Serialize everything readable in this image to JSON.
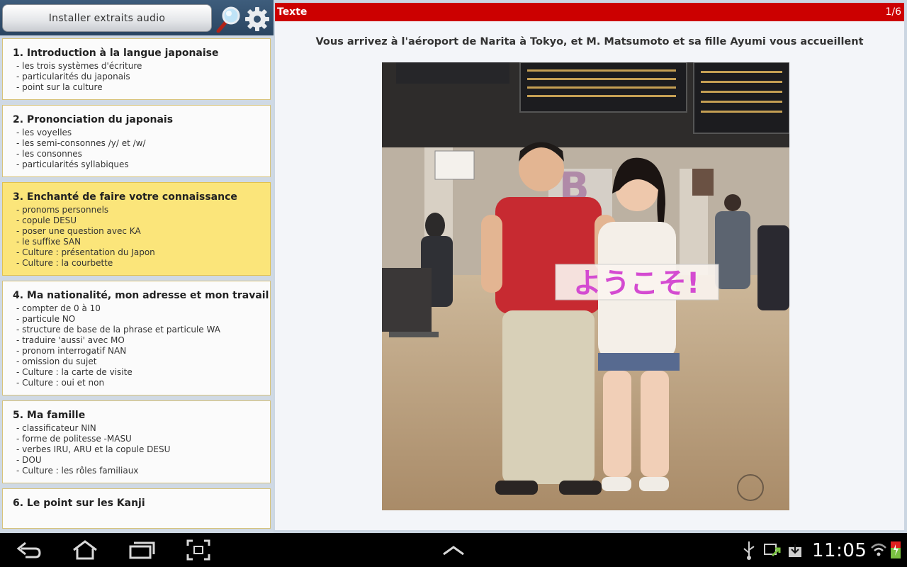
{
  "sidebar": {
    "install_label": "Installer extraits audio",
    "lessons": [
      {
        "title": "1. Introduction à la langue japonaise",
        "items": [
          "- les trois systèmes d'écriture",
          "- particularités du japonais",
          "- point sur la culture"
        ]
      },
      {
        "title": "2. Prononciation du japonais",
        "items": [
          "- les voyelles",
          "- les semi-consonnes /y/ et /w/",
          "- les consonnes",
          "- particularités syllabiques"
        ]
      },
      {
        "title": "3. Enchanté de faire votre connaissance",
        "items": [
          "- pronoms personnels",
          "- copule DESU",
          "- poser une question avec KA",
          "- le suffixe SAN",
          "- Culture : présentation du Japon",
          "- Culture : la courbette"
        ]
      },
      {
        "title": "4. Ma nationalité, mon adresse et mon travail",
        "items": [
          "- compter de 0 à 10",
          "- particule NO",
          "- structure de base de la phrase et particule WA",
          "- traduire 'aussi' avec MO",
          "- pronom interrogatif NAN",
          "- omission du sujet",
          "- Culture : la carte de visite",
          "- Culture : oui et non"
        ]
      },
      {
        "title": "5. Ma famille",
        "items": [
          "- classificateur NIN",
          "- forme de politesse -MASU",
          "- verbes IRU, ARU et la copule DESU",
          "- DOU",
          "- Culture : les rôles familiaux"
        ]
      },
      {
        "title": "6. Le point sur les Kanji",
        "items": []
      }
    ]
  },
  "content": {
    "header_title": "Texte",
    "page_indicator": "1/6",
    "caption": "Vous arrivez à l'aéroport de Narita à Tokyo, et M. Matsumoto et sa fille Ayumi vous accueillent",
    "sign_text": "ようこそ!",
    "gate_letter": "B"
  },
  "status_bar": {
    "time": "11:05"
  },
  "colors": {
    "header_red": "#cc0000",
    "selected_lesson": "#fbe57a",
    "lesson_border": "#d7c27a"
  }
}
